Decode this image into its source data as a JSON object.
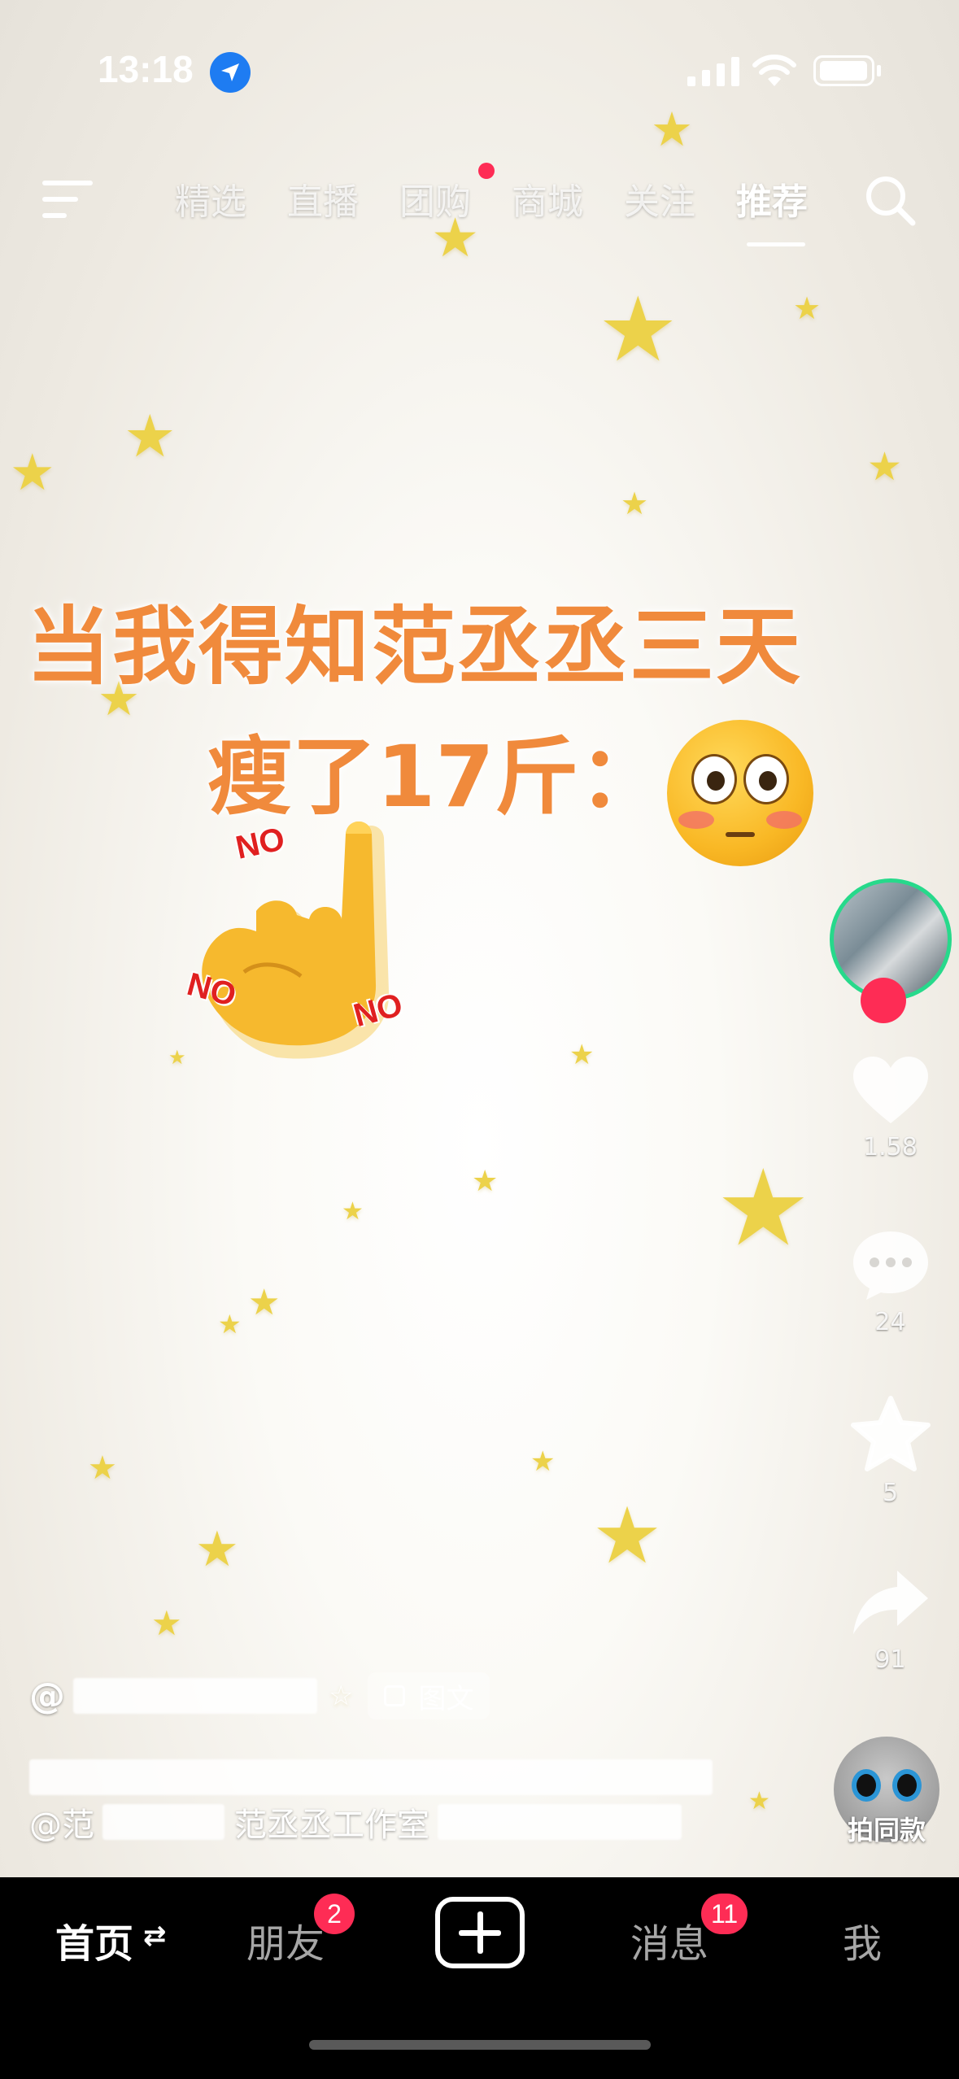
{
  "status_bar": {
    "time": "13:18"
  },
  "top_nav": {
    "tabs": [
      "精选",
      "直播",
      "团购",
      "商城",
      "关注",
      "推荐"
    ],
    "active_tab": "推荐"
  },
  "post": {
    "caption_line1": "当我得知范丞丞三天",
    "caption_line2": "瘦了17斤：",
    "no_labels": [
      "NO",
      "NO",
      "NO"
    ]
  },
  "actions": {
    "like_count": "1.58",
    "comment_count": "24",
    "favorite_count": "5",
    "share_count": "91",
    "same_style_label": "拍同款"
  },
  "author": {
    "prefix": "@",
    "tag_label": "图文"
  },
  "description": {
    "mention_prefix": "@范",
    "mention_mid": "范丞丞工作室"
  },
  "tab_bar": {
    "home": "首页",
    "friends": "朋友",
    "friends_badge": "2",
    "messages": "消息",
    "messages_badge": "11",
    "me": "我"
  },
  "colors": {
    "accent": "#fe2c55",
    "caption": "#f08a3c",
    "star": "#ecd24a"
  }
}
